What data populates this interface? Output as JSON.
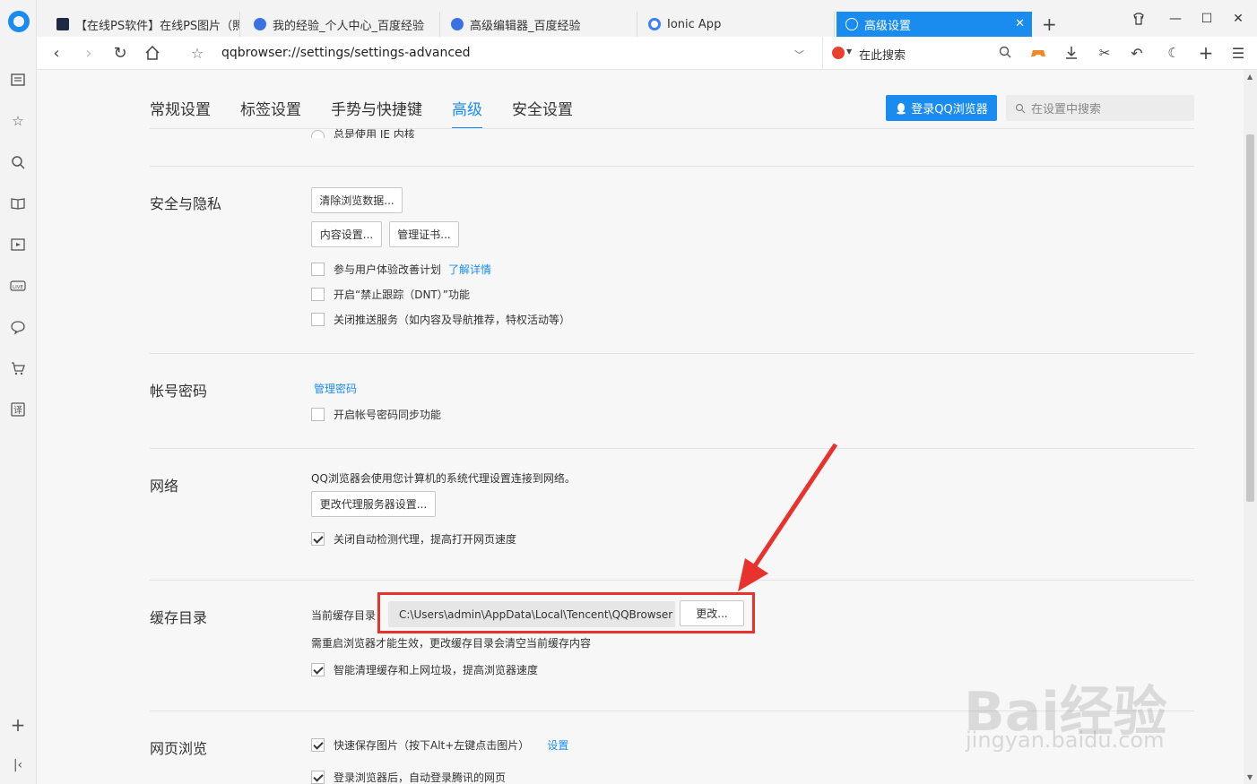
{
  "tabs": [
    {
      "label": "【在线PS软件】在线PS图片（照",
      "active": false
    },
    {
      "label": "我的经验_个人中心_百度经验",
      "active": false
    },
    {
      "label": "高级编辑器_百度经验",
      "active": false
    },
    {
      "label": "Ionic App",
      "active": false
    },
    {
      "label": "高级设置",
      "active": true
    }
  ],
  "toolbar": {
    "url": "qqbrowser://settings/settings-advanced",
    "search_text": "在此搜索"
  },
  "settings_nav": {
    "items": [
      "常规设置",
      "标签设置",
      "手势与快捷键",
      "高级",
      "安全设置"
    ],
    "active": "高级",
    "login_label": "登录QQ浏览器",
    "search_placeholder": "在设置中搜索"
  },
  "sections": {
    "partial_option": "总是使用 IE 内核",
    "security": {
      "title": "安全与隐私",
      "clear_data_label": "清除浏览数据...",
      "content_settings_label": "内容设置...",
      "manage_certs_label": "管理证书...",
      "ux_plan_label": "参与用户体验改善计划",
      "ux_plan_link": "了解详情",
      "dnt_label": "开启“禁止跟踪（DNT）”功能",
      "push_label": "关闭推送服务（如内容及导航推荐，特权活动等）"
    },
    "account": {
      "title": "帐号密码",
      "manage_link": "管理密码",
      "sync_label": "开启帐号密码同步功能"
    },
    "network": {
      "title": "网络",
      "desc": "QQ浏览器会使用您计算机的系统代理设置连接到网络。",
      "proxy_button": "更改代理服务器设置...",
      "auto_proxy_label": "关闭自动检测代理，提高打开网页速度"
    },
    "cache": {
      "title": "缓存目录",
      "current_label": "当前缓存目录",
      "path": "C:\\Users\\admin\\AppData\\Local\\Tencent\\QQBrowser",
      "change_button": "更改...",
      "note": "需重启浏览器才能生效，更改缓存目录会清空当前缓存内容",
      "smart_clean_label": "智能清理缓存和上网垃圾，提高浏览器速度"
    },
    "browsing": {
      "title": "网页浏览",
      "quick_save_label": "快速保存图片（按下Alt+左键点击图片）",
      "quick_save_link": "设置",
      "auto_login_label": "登录浏览器后，自动登录腾讯的网页"
    }
  },
  "watermark": {
    "brand": "Bai经验",
    "url": "jingyan.baidu.com"
  },
  "colors": {
    "accent": "#1a8cf0",
    "highlight": "#e8322e"
  }
}
